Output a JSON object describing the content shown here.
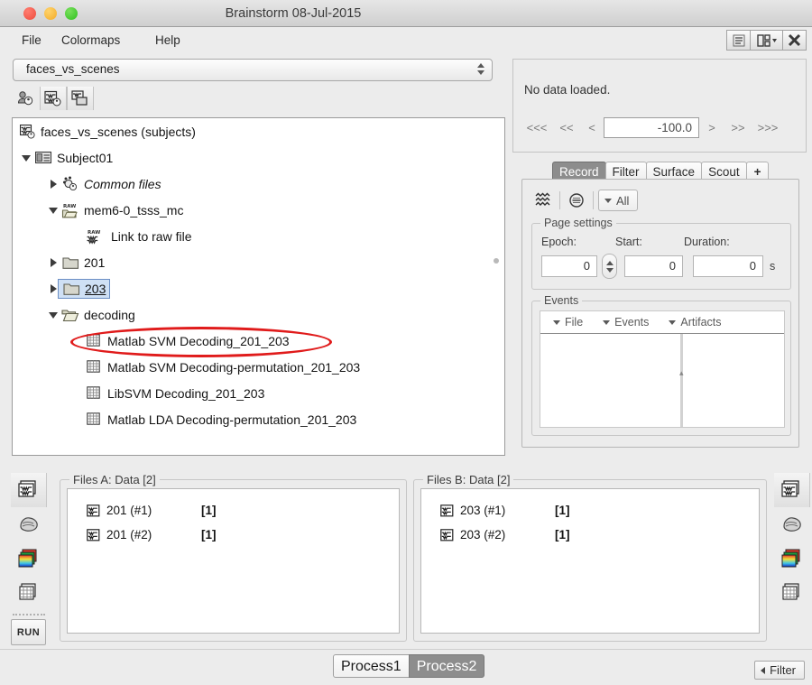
{
  "window": {
    "title": "Brainstorm 08-Jul-2015",
    "traffic_lights": [
      "close-red",
      "minimize-yellow",
      "zoom-green"
    ],
    "buttons": [
      {
        "name": "layout-list-button",
        "icon": "list-layout-icon"
      },
      {
        "name": "layout-select-button",
        "icon": "window-layout-icon"
      },
      {
        "name": "close-button",
        "icon": "x-icon"
      }
    ]
  },
  "menubar": {
    "items": [
      {
        "label": "File"
      },
      {
        "label": "Colormaps"
      },
      {
        "label": "Help"
      }
    ]
  },
  "protocol": {
    "selected": "faces_vs_scenes",
    "toolbar": [
      {
        "name": "protocol-subjects-button",
        "icon": "subjects-icon"
      },
      {
        "name": "protocol-studies-button",
        "icon": "studies-icon"
      },
      {
        "name": "protocol-functional-button",
        "icon": "functional-icon"
      }
    ]
  },
  "tree": {
    "root": "faces_vs_scenes (subjects)",
    "nodes": [
      {
        "label": "faces_vs_scenes (subjects)",
        "indent": 0,
        "twisty": "none",
        "icon": "protocol-icon",
        "italic": false,
        "selected": false
      },
      {
        "label": "Subject01",
        "indent": 1,
        "twisty": "open",
        "icon": "subject-icon",
        "italic": false,
        "selected": false
      },
      {
        "label": "Common files",
        "indent": 2,
        "twisty": "closed",
        "icon": "common-files-icon",
        "italic": true,
        "selected": false
      },
      {
        "label": "mem6-0_tsss_mc",
        "indent": 2,
        "twisty": "open",
        "icon": "raw-folder-icon",
        "italic": false,
        "selected": false
      },
      {
        "label": "Link to raw file",
        "indent": 3,
        "twisty": "none",
        "icon": "raw-link-icon",
        "italic": false,
        "selected": false
      },
      {
        "label": "201",
        "indent": 2,
        "twisty": "closed",
        "icon": "folder-icon",
        "italic": false,
        "selected": false
      },
      {
        "label": "203",
        "indent": 2,
        "twisty": "closed",
        "icon": "folder-icon",
        "italic": false,
        "selected": true
      },
      {
        "label": "decoding",
        "indent": 2,
        "twisty": "open",
        "icon": "open-folder-icon",
        "italic": false,
        "selected": false
      },
      {
        "label": "Matlab SVM Decoding_201_203",
        "indent": 3,
        "twisty": "none",
        "icon": "matrix-icon",
        "italic": false,
        "selected": false
      },
      {
        "label": "Matlab SVM Decoding-permutation_201_203",
        "indent": 3,
        "twisty": "none",
        "icon": "matrix-icon",
        "italic": false,
        "selected": false
      },
      {
        "label": "LibSVM Decoding_201_203",
        "indent": 3,
        "twisty": "none",
        "icon": "matrix-icon",
        "italic": false,
        "selected": false
      },
      {
        "label": "Matlab LDA Decoding-permutation_201_203",
        "indent": 3,
        "twisty": "none",
        "icon": "matrix-icon",
        "italic": false,
        "selected": false
      }
    ],
    "annotation": {
      "shape": "ellipse",
      "color": "#e01b1b",
      "targets": "Matlab SVM Decoding_201_203"
    }
  },
  "viewer": {
    "status": "No data loaded.",
    "nav": {
      "first": "<<<",
      "prev_page": "<<",
      "prev": "<",
      "time_value": "-100.0",
      "next": ">",
      "next_page": ">>",
      "last": ">>>"
    }
  },
  "tabs": {
    "items": [
      {
        "label": "Record",
        "active": true
      },
      {
        "label": "Filter",
        "active": false
      },
      {
        "label": "Surface",
        "active": false
      },
      {
        "label": "Scout",
        "active": false
      },
      {
        "label": "+",
        "active": false
      }
    ]
  },
  "record": {
    "toolbar": [
      {
        "name": "display-mode-button",
        "icon": "waves-icon"
      },
      {
        "name": "montage-button",
        "icon": "circle-minus-icon"
      },
      {
        "name": "montage-select-button",
        "label": "All",
        "icon": "chevron-down-icon"
      }
    ],
    "page_settings": {
      "title": "Page settings",
      "epoch_label": "Epoch:",
      "epoch_value": "0",
      "start_label": "Start:",
      "start_value": "0",
      "duration_label": "Duration:",
      "duration_value": "0",
      "unit": "s"
    },
    "events": {
      "title": "Events",
      "columns": [
        "File",
        "Events",
        "Artifacts"
      ],
      "rows": []
    }
  },
  "process": {
    "left_toolbar": [
      {
        "name": "process-data-button",
        "icon": "recordings-stack-icon",
        "active": true
      },
      {
        "name": "process-sources-button",
        "icon": "sources-icon",
        "active": false
      },
      {
        "name": "process-timefreq-button",
        "icon": "timefreq-icon",
        "active": false
      },
      {
        "name": "process-matrix-button",
        "icon": "matrix-stack-icon",
        "active": false
      }
    ],
    "run_label": "RUN",
    "right_toolbar": [
      {
        "name": "processb-data-button",
        "icon": "recordings-stack-icon",
        "active": true
      },
      {
        "name": "processb-sources-button",
        "icon": "sources-icon",
        "active": false
      },
      {
        "name": "processb-timefreq-button",
        "icon": "timefreq-icon",
        "active": false
      },
      {
        "name": "processb-matrix-button",
        "icon": "matrix-stack-icon",
        "active": false
      }
    ],
    "files_a": {
      "title": "Files A: Data [2]",
      "rows": [
        {
          "name": "201 (#1)",
          "count": "[1]"
        },
        {
          "name": "201 (#2)",
          "count": "[1]"
        }
      ]
    },
    "files_b": {
      "title": "Files B: Data [2]",
      "rows": [
        {
          "name": "203 (#1)",
          "count": "[1]"
        },
        {
          "name": "203 (#2)",
          "count": "[1]"
        }
      ]
    },
    "tabs": [
      {
        "label": "Process1",
        "selected": false
      },
      {
        "label": "Process2",
        "selected": true
      }
    ],
    "filter_button": "Filter"
  },
  "colors": {
    "background": "#ececec",
    "panel": "#ffffff",
    "selection": "#cfe0f5",
    "accent_tab": "#8d8d8d",
    "annotation": "#e01b1b"
  }
}
